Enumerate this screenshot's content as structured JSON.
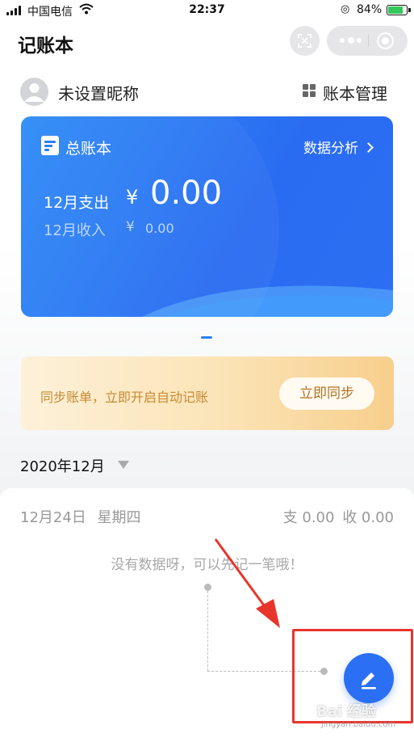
{
  "status_bar": {
    "carrier": "中国电信",
    "time": "22:37",
    "battery_percent": "84%",
    "battery_level": 0.84,
    "icons": [
      "signal-icon",
      "wifi-icon",
      "orientation-lock-icon",
      "battery-charging-icon"
    ]
  },
  "nav": {
    "title": "记账本",
    "scan_icon": "scan-icon",
    "more_icon": "more-icon",
    "close_icon": "close-icon"
  },
  "user": {
    "nickname": "未设置昵称",
    "book_manage": "账本管理"
  },
  "ledger_card": {
    "name": "总账本",
    "analysis_link": "数据分析",
    "expense_label": "12月支出",
    "expense_currency": "¥",
    "expense_value": "0.00",
    "income_label": "12月收入",
    "income_currency": "¥",
    "income_value": "0.00",
    "color": "#2f80f6"
  },
  "sync_banner": {
    "text": "同步账单，立即开启自动记账",
    "button": "立即同步"
  },
  "month_selector": {
    "value": "2020年12月"
  },
  "day_record": {
    "date": "12月24日",
    "weekday": "星期四",
    "expense_label": "支",
    "expense_value": "0.00",
    "income_label": "收",
    "income_value": "0.00",
    "empty_tip": "没有数据呀，可以先记一笔哦！"
  },
  "fab": {
    "icon": "pencil-icon",
    "color": "#2b6ff4"
  },
  "annotation": {
    "color": "#e8352c"
  },
  "watermark": {
    "text": "Bai 经验",
    "sub": "jingyan.baidu.com"
  }
}
